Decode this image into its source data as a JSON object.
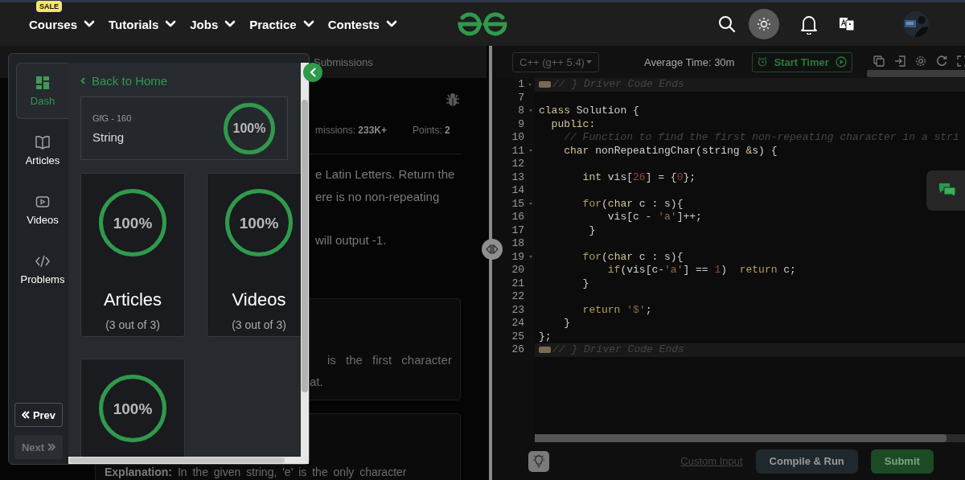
{
  "nav": {
    "items": [
      {
        "label": "Courses",
        "badge": "SALE"
      },
      {
        "label": "Tutorials"
      },
      {
        "label": "Jobs"
      },
      {
        "label": "Practice"
      },
      {
        "label": "Contests"
      }
    ]
  },
  "problem": {
    "tabs": [
      {
        "label": "Submissions",
        "selected": false
      }
    ],
    "stats": [
      "missions: **233K+**",
      "Points: **2**"
    ],
    "paragraphs": [
      {
        "lines": [
          "e Latin Letters. Return the",
          "ere is no non-repeating"
        ]
      },
      {
        "lines": [
          "will output -1."
        ]
      }
    ],
    "examples": [
      {
        "lines": [
          "is the first character",
          "at."
        ]
      },
      {
        "lines": [
          "**Explanation:** In the given string, 'e' is the only character"
        ]
      }
    ]
  },
  "drawer": {
    "rail": [
      {
        "label": "Dash",
        "selected": true
      },
      {
        "label": "Articles",
        "selected": false
      },
      {
        "label": "Videos",
        "selected": false
      },
      {
        "label": "Problems",
        "selected": false
      }
    ],
    "nav_buttons": [
      {
        "label": "Prev",
        "disabled": false
      },
      {
        "label": "Next",
        "disabled": true
      }
    ],
    "back": "Back to Home",
    "summary": {
      "subtitle": "GfG - 160",
      "title": "String",
      "progress": {
        "text": "100%",
        "level": 1
      }
    },
    "cards": [
      {
        "title": "Articles",
        "count": "(3 out of 3)",
        "progress": {
          "text": "100%",
          "level": 1
        }
      },
      {
        "title": "Videos",
        "count": "(3 out of 3)",
        "progress": {
          "text": "100%",
          "level": 1
        }
      },
      {
        "progress": {
          "text": "100%",
          "level": 1
        }
      }
    ]
  },
  "editor": {
    "language": "C++ (g++ 5.4)",
    "average_time": "Average Time: 30m",
    "timer": "Start Timer",
    "lines": [
      {
        "n": "1",
        "foldable": true,
        "collapsed": true,
        "tokens": [
          {
            "kind": "comment",
            "t": "// } Driver Code Ends"
          }
        ]
      },
      {
        "n": "7",
        "foldable": false,
        "collapsed": false
      },
      {
        "n": "8",
        "foldable": true,
        "collapsed": false,
        "tokens": [
          {
            "kind": "keyword",
            "t": "class"
          },
          {
            "kind": "plain",
            "t": " Solution {"
          }
        ]
      },
      {
        "n": "9",
        "foldable": false,
        "collapsed": false,
        "tokens": [
          {
            "kind": "keyword",
            "t": "  public:"
          }
        ]
      },
      {
        "n": "10",
        "foldable": false,
        "collapsed": false,
        "tokens": [
          {
            "kind": "comment",
            "t": "    // Function to find the first non-repeating character in a stri"
          }
        ]
      },
      {
        "n": "11",
        "foldable": true,
        "collapsed": false,
        "tokens": [
          {
            "kind": "keyword",
            "t": "    char"
          },
          {
            "kind": "plain",
            "t": " nonRepeatingChar(string "
          },
          {
            "kind": "keyword",
            "t": "&"
          },
          {
            "kind": "plain",
            "t": "s) {"
          }
        ]
      },
      {
        "n": "12",
        "foldable": false,
        "collapsed": false
      },
      {
        "n": "13",
        "foldable": false,
        "collapsed": false,
        "tokens": [
          {
            "kind": "keyword",
            "t": "       int"
          },
          {
            "kind": "plain",
            "t": " vis["
          },
          {
            "kind": "number",
            "t": "26"
          },
          {
            "kind": "plain",
            "t": "] = {"
          },
          {
            "kind": "number",
            "t": "0"
          },
          {
            "kind": "plain",
            "t": "};"
          }
        ]
      },
      {
        "n": "14",
        "foldable": false,
        "collapsed": false
      },
      {
        "n": "15",
        "foldable": true,
        "collapsed": false,
        "tokens": [
          {
            "kind": "control",
            "t": "       for"
          },
          {
            "kind": "plain",
            "t": "("
          },
          {
            "kind": "keyword",
            "t": "char"
          },
          {
            "kind": "plain",
            "t": " c : s){"
          }
        ]
      },
      {
        "n": "16",
        "foldable": false,
        "collapsed": false,
        "tokens": [
          {
            "kind": "plain",
            "t": "           vis[c - "
          },
          {
            "kind": "string",
            "t": "'a'"
          },
          {
            "kind": "plain",
            "t": "]++;"
          }
        ]
      },
      {
        "n": "17",
        "foldable": false,
        "collapsed": false,
        "tokens": [
          {
            "kind": "plain",
            "t": "        }"
          }
        ]
      },
      {
        "n": "18",
        "foldable": false,
        "collapsed": false
      },
      {
        "n": "19",
        "foldable": true,
        "collapsed": false,
        "tokens": [
          {
            "kind": "control",
            "t": "       for"
          },
          {
            "kind": "plain",
            "t": "("
          },
          {
            "kind": "keyword",
            "t": "char"
          },
          {
            "kind": "plain",
            "t": " c : s){"
          }
        ]
      },
      {
        "n": "20",
        "foldable": false,
        "collapsed": false,
        "tokens": [
          {
            "kind": "control",
            "t": "           if"
          },
          {
            "kind": "plain",
            "t": "(vis[c-"
          },
          {
            "kind": "string",
            "t": "'a'"
          },
          {
            "kind": "plain",
            "t": "] == "
          },
          {
            "kind": "number",
            "t": "1"
          },
          {
            "kind": "plain",
            "t": ")  "
          },
          {
            "kind": "control",
            "t": "return"
          },
          {
            "kind": "plain",
            "t": " c;"
          }
        ]
      },
      {
        "n": "21",
        "foldable": false,
        "collapsed": false,
        "tokens": [
          {
            "kind": "plain",
            "t": "       }"
          }
        ]
      },
      {
        "n": "22",
        "foldable": false,
        "collapsed": false
      },
      {
        "n": "23",
        "foldable": false,
        "collapsed": false,
        "tokens": [
          {
            "kind": "control",
            "t": "       return"
          },
          {
            "kind": "string",
            "t": " '$'"
          },
          {
            "kind": "plain",
            "t": ";"
          }
        ]
      },
      {
        "n": "24",
        "foldable": false,
        "collapsed": false,
        "tokens": [
          {
            "kind": "plain",
            "t": "    }"
          }
        ]
      },
      {
        "n": "25",
        "foldable": false,
        "collapsed": false,
        "tokens": [
          {
            "kind": "plain",
            "t": "};"
          }
        ]
      },
      {
        "n": "26",
        "foldable": false,
        "collapsed": true,
        "tokens": [
          {
            "kind": "comment",
            "t": "// } Driver Code Ends"
          }
        ]
      }
    ],
    "custom_input": "Custom Input",
    "compile": "Compile & Run",
    "submit": "Submit"
  }
}
